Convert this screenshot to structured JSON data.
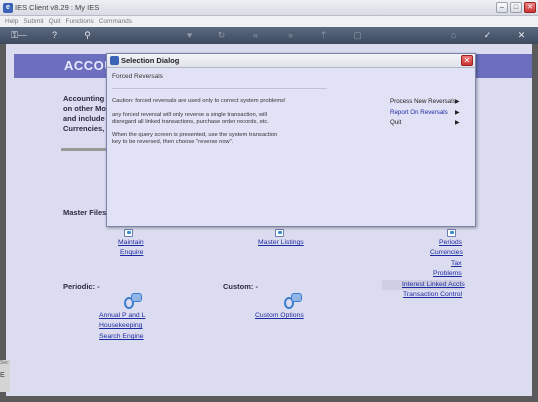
{
  "window": {
    "title": "IES Client v8.29 : My IES",
    "buttons": {
      "minimize": "–",
      "maximize": "□",
      "close": "✕"
    }
  },
  "menubar": [
    "Help",
    "Submit",
    "Quit",
    "Functions",
    "Commands"
  ],
  "toolbar": {
    "icons": [
      "key-icon",
      "help-icon",
      "search-icon",
      "heart-icon",
      "refresh-icon",
      "back-icon",
      "forward-icon",
      "up-icon",
      "stop-icon",
      "home-icon",
      "ok-icon",
      "cancel-icon"
    ]
  },
  "page": {
    "header_title": "ACCOU",
    "intro_lines": [
      "Accounting C",
      "on other Mo",
      "and include",
      "Currencies, I"
    ]
  },
  "sections": {
    "master_files_label": "Master Files:",
    "periodic_label": "Periodic: -",
    "custom_label": "Custom: -"
  },
  "links": {
    "maintain": "Maintain",
    "enquire": "Enquire",
    "master_listings": "Master Listings",
    "periods": "Periods",
    "currencies": "Currencies",
    "tax": "Tax",
    "problems": "Problems",
    "interest_linked_accts": "Interest Linked Accts",
    "transaction_control": "Transaction Control",
    "annual_p_and_l": "Annual P and L",
    "housekeeping": "Housekeeping",
    "search_engine": "Search Engine",
    "custom_options": "Custom Options"
  },
  "dialog": {
    "title": "Selection Dialog",
    "close_label": "✕",
    "subtitle": "Forced Reversals",
    "caution": "Caution: forced reversals are used only to correct system problems!",
    "para1_line1": "any forced reversal will only reverse a single transaction, will",
    "para1_line2": "disregard all linked transactions, purchase order records, etc.",
    "para2_line1": "When the query screen is presented, use the system transaction",
    "para2_line2": "key to be reversed, then choose \"reverse now\".",
    "menu": [
      {
        "label": "Process New Reversals",
        "arrow": "▶"
      },
      {
        "label": "Report On Reversals",
        "arrow": "▶"
      },
      {
        "label": "Quit",
        "arrow": "▶"
      }
    ]
  },
  "sidebar_strip": {
    "text1": "Sec",
    "text2": "E"
  },
  "colors": {
    "header_band": "#6b6fbe",
    "main_background": "#dcdcf0",
    "link": "#1c2aa0",
    "toolbar": "#4a566b",
    "dialog_background": "#e2e2f6",
    "close_red": "#c33"
  }
}
